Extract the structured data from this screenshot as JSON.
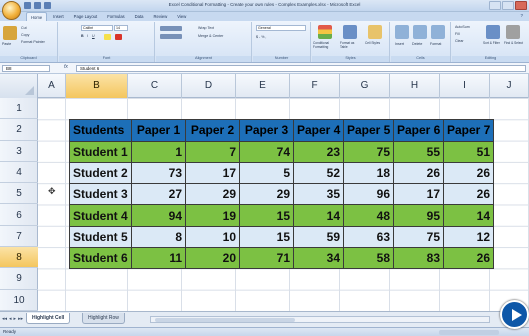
{
  "window": {
    "title": "Excel Conditional Formatting - Create your own rules - Complex Examples.xlsx - Microsoft Excel"
  },
  "ribbon_tabs": [
    "Home",
    "Insert",
    "Page Layout",
    "Formulas",
    "Data",
    "Review",
    "View"
  ],
  "ribbon": {
    "clipboard": {
      "paste": "Paste",
      "cut": "Cut",
      "copy": "Copy",
      "format_painter": "Format Painter",
      "label": "Clipboard"
    },
    "font": {
      "font_name": "Calibri",
      "font_size": "14",
      "label": "Font"
    },
    "alignment": {
      "wrap_text": "Wrap Text",
      "merge_center": "Merge & Center",
      "label": "Alignment"
    },
    "number": {
      "format": "General",
      "label": "Number"
    },
    "styles": {
      "conditional_formatting": "Conditional Formatting",
      "format_as_table": "Format as Table",
      "cell_styles": "Cell Styles",
      "label": "Styles"
    },
    "cells": {
      "insert": "Insert",
      "delete": "Delete",
      "format": "Format",
      "label": "Cells"
    },
    "editing": {
      "autosum": "AutoSum",
      "fill": "Fill",
      "clear": "Clear",
      "sort_filter": "Sort & Filter",
      "find_select": "Find & Select",
      "label": "Editing"
    }
  },
  "formula_bar": {
    "name_box": "B8",
    "fx": "fx",
    "value": "Student 6"
  },
  "columns": [
    "A",
    "B",
    "C",
    "D",
    "E",
    "F",
    "G",
    "H",
    "I",
    "J"
  ],
  "selected_column": "B",
  "rows": [
    "1",
    "2",
    "3",
    "4",
    "5",
    "6",
    "7",
    "8",
    "9",
    "10"
  ],
  "selected_row": "8",
  "table": {
    "headers": [
      "Students",
      "Paper 1",
      "Paper 2",
      "Paper 3",
      "Paper 4",
      "Paper 5",
      "Paper 6",
      "Paper 7"
    ],
    "rows": [
      {
        "name": "Student 1",
        "values": [
          "1",
          "7",
          "74",
          "23",
          "75",
          "55",
          "51"
        ],
        "style": "green"
      },
      {
        "name": "Student 2",
        "values": [
          "73",
          "17",
          "5",
          "52",
          "18",
          "26",
          "26"
        ],
        "style": "lite"
      },
      {
        "name": "Student 3",
        "values": [
          "27",
          "29",
          "29",
          "35",
          "96",
          "17",
          "26"
        ],
        "style": "lite"
      },
      {
        "name": "Student 4",
        "values": [
          "94",
          "19",
          "15",
          "14",
          "48",
          "95",
          "14"
        ],
        "style": "green"
      },
      {
        "name": "Student 5",
        "values": [
          "8",
          "10",
          "15",
          "59",
          "63",
          "75",
          "12"
        ],
        "style": "lite"
      },
      {
        "name": "Student 6",
        "values": [
          "11",
          "20",
          "71",
          "34",
          "58",
          "83",
          "26"
        ],
        "style": "green"
      }
    ]
  },
  "sheet_tabs": [
    "Highlight Cell",
    "Highlight Row"
  ],
  "active_sheet": "Highlight Cell",
  "status": {
    "text": "Ready"
  },
  "colors": {
    "header_blue": "#1d6fb8",
    "row_green": "#7cc143",
    "row_light": "#dbe9f6"
  }
}
